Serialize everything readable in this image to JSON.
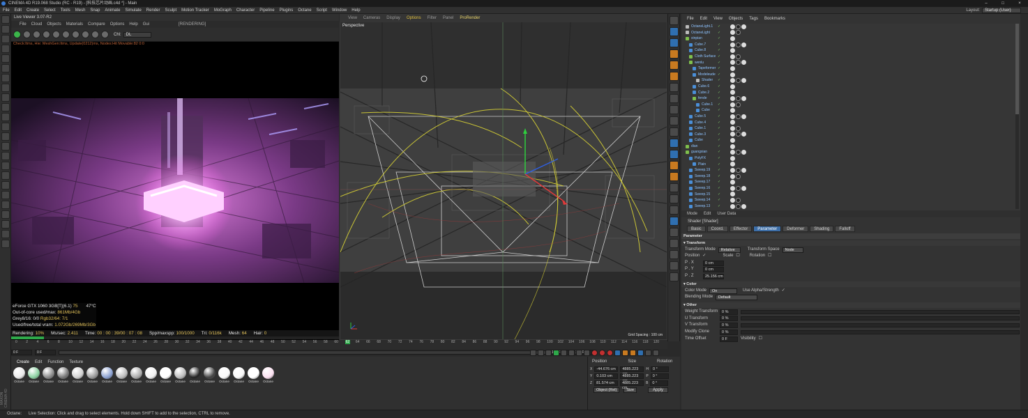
{
  "window": {
    "title": "CINEMA 4D R19.068 Studio (RC - R19) - [科技芯片动画.c4d *] - Main",
    "controls": [
      "–",
      "□",
      "×"
    ]
  },
  "menubar": [
    "File",
    "Edit",
    "Create",
    "Select",
    "Tools",
    "Mesh",
    "Snap",
    "Animate",
    "Simulate",
    "Render",
    "Sculpt",
    "Motion Tracker",
    "MoGraph",
    "Character",
    "Pipeline",
    "Plugins",
    "Octane",
    "Script",
    "Window",
    "Help"
  ],
  "layout": {
    "label": "Layout:",
    "value": "Startup (User)"
  },
  "liveviewer": {
    "title": "Live Viewer 3.07-R2",
    "menu": [
      "File",
      "Cloud",
      "Objects",
      "Materials",
      "Compare",
      "Options",
      "Help",
      "Gui"
    ],
    "status": "[RENDERING]",
    "channel_label": "Chl:",
    "channel_value": "DL",
    "checkline": "Check:Itms, Hie: MeshGen:Itms, Update(0212)ms, Nodes:Hit Movable:82 0:0",
    "stats": [
      {
        "label": "eForce GTX 1060 3GB[T](6.1)",
        "value": "75",
        "extra": "47°C"
      },
      {
        "label": "Out-of-core used/max:",
        "value": "861Mb/4Gb"
      },
      {
        "label": "Grey8/16: 0/0",
        "value": "Rgb32/64: 7/1"
      },
      {
        "label": "Used/free/total vram:",
        "value": "1.072Gb/269Mb/3Gb"
      }
    ],
    "bar": [
      {
        "label": "Rendering:",
        "value": "10%"
      },
      {
        "label": "Ms/sec:",
        "value": "2.411"
      },
      {
        "label": "Time:",
        "value": "00 : 00 : 39/00 : 07 : 08"
      },
      {
        "label": "Spp/maxspp:",
        "value": "100/1000"
      },
      {
        "label": "Tri:",
        "value": "0/116k"
      },
      {
        "label": "Mesh:",
        "value": "64"
      },
      {
        "label": "Hair:",
        "value": "0"
      }
    ],
    "progress": 0.1
  },
  "viewport": {
    "menu": [
      "View",
      "Cameras",
      "Display",
      "Options",
      "Filter",
      "Panel",
      "ProRender"
    ],
    "active_menu": "Options",
    "label": "Perspective",
    "grid": "Grid Spacing : 100 cm"
  },
  "objects": {
    "menu": [
      "File",
      "Edit",
      "View",
      "Objects",
      "Tags",
      "Bookmarks"
    ],
    "items": [
      {
        "name": "OctaneLight.1",
        "indent": 0,
        "icon": "w"
      },
      {
        "name": "OctaneLight",
        "indent": 0,
        "icon": "w"
      },
      {
        "name": "xinpian",
        "indent": 0,
        "icon": "g"
      },
      {
        "name": "Cube.7",
        "indent": 1,
        "icon": "b"
      },
      {
        "name": "Cube.8",
        "indent": 1,
        "icon": "b"
      },
      {
        "name": "Cloth Surface",
        "indent": 1,
        "icon": "g"
      },
      {
        "name": "wenlu",
        "indent": 1,
        "icon": "g"
      },
      {
        "name": "Tapeformer",
        "indent": 2,
        "icon": "b"
      },
      {
        "name": "Modeleude",
        "indent": 2,
        "icon": "b"
      },
      {
        "name": "Shader",
        "indent": 3,
        "icon": "w"
      },
      {
        "name": "Cube.6",
        "indent": 2,
        "icon": "b"
      },
      {
        "name": "Cube.2",
        "indent": 2,
        "icon": "b"
      },
      {
        "name": "fende",
        "indent": 2,
        "icon": "g"
      },
      {
        "name": "Cube.1",
        "indent": 3,
        "icon": "b"
      },
      {
        "name": "Cube",
        "indent": 3,
        "icon": "b"
      },
      {
        "name": "Cube.5",
        "indent": 1,
        "icon": "b"
      },
      {
        "name": "Cube.4",
        "indent": 1,
        "icon": "b"
      },
      {
        "name": "Cube.1",
        "indent": 1,
        "icon": "b"
      },
      {
        "name": "Cube.3",
        "indent": 1,
        "icon": "b"
      },
      {
        "name": "Cube",
        "indent": 1,
        "icon": "b"
      },
      {
        "name": "dian",
        "indent": 0,
        "icon": "g"
      },
      {
        "name": "guangxian",
        "indent": 0,
        "icon": "g"
      },
      {
        "name": "PolyFX",
        "indent": 1,
        "icon": "b"
      },
      {
        "name": "Plain",
        "indent": 2,
        "icon": "b"
      },
      {
        "name": "Sweep.19",
        "indent": 1,
        "icon": "b"
      },
      {
        "name": "Sweep.18",
        "indent": 1,
        "icon": "b"
      },
      {
        "name": "Sweep.17",
        "indent": 1,
        "icon": "b"
      },
      {
        "name": "Sweep.16",
        "indent": 1,
        "icon": "b"
      },
      {
        "name": "Sweep.15",
        "indent": 1,
        "icon": "b"
      },
      {
        "name": "Sweep.14",
        "indent": 1,
        "icon": "b"
      },
      {
        "name": "Sweep.13",
        "indent": 1,
        "icon": "b"
      }
    ]
  },
  "attributes": {
    "menu": [
      "Mode",
      "Edit",
      "User Data"
    ],
    "title": "Shader [Shader]",
    "tabs": [
      "Basic",
      "Coord.",
      "Effector",
      "Parameter",
      "Deformer",
      "Shading",
      "Falloff"
    ],
    "active_tab": "Parameter",
    "section_parameter": "Parameter",
    "section_transform": "Transform",
    "transform_mode_label": "Transform Mode",
    "transform_mode": "Relative",
    "transform_space_label": "Transform Space",
    "transform_space": "Node",
    "position_label": "Position",
    "scale_label": "Scale",
    "rotation_label": "Rotation",
    "px_label": "P . X",
    "px": "0 cm",
    "py_label": "P . Y",
    "py": "0 cm",
    "pz_label": "P . Z",
    "pz": "25.156 cm",
    "section_color": "Color",
    "color_mode_label": "Color Mode",
    "color_mode": "On",
    "use_alpha_label": "Use Alpha/Strength",
    "blending_mode_label": "Blending Mode",
    "blending_mode": "Default",
    "section_other": "Other",
    "others": [
      {
        "label": "Weight Transform",
        "value": "0 %"
      },
      {
        "label": "U Transform",
        "value": "0 %"
      },
      {
        "label": "V Transform",
        "value": "0 %"
      },
      {
        "label": "Modify Clone",
        "value": "0 %"
      }
    ],
    "time_offset_label": "Time Offset",
    "time_offset": "0 F",
    "visibility_label": "Visibility"
  },
  "timeline": {
    "ticks": [
      "0",
      "2",
      "4",
      "6",
      "8",
      "10",
      "12",
      "14",
      "16",
      "18",
      "20",
      "22",
      "24",
      "26",
      "28",
      "30",
      "32",
      "34",
      "36",
      "38",
      "40",
      "42",
      "44",
      "46",
      "48",
      "50",
      "52",
      "54",
      "56",
      "58",
      "60",
      "62",
      "64",
      "66",
      "68",
      "70",
      "72",
      "74",
      "76",
      "78",
      "80",
      "82",
      "84",
      "86",
      "88",
      "90",
      "92",
      "94",
      "96",
      "98",
      "100",
      "102",
      "104",
      "106",
      "108",
      "110",
      "112",
      "114",
      "116",
      "118",
      "120"
    ],
    "current": "62",
    "start": "0 F",
    "min": "0 F",
    "end": "110 F",
    "max": "110 F"
  },
  "materials": {
    "menu": [
      "Create",
      "Edit",
      "Function",
      "Texture"
    ],
    "items": [
      "Octane",
      "Octane",
      "Octane",
      "Octane",
      "Octane",
      "Octane",
      "Octane",
      "Octane",
      "Octane",
      "Octane",
      "Octane",
      "Octane",
      "Octane",
      "Octane",
      "Octane",
      "Octane",
      "Octane",
      "Octane"
    ]
  },
  "coords": {
    "headers": [
      "Position",
      "Size",
      "Rotation"
    ],
    "rows": [
      {
        "axis": "X",
        "pos": "-44.676 cm",
        "size": "4885.223 cm",
        "rl": "H",
        "rot": "0 °"
      },
      {
        "axis": "Y",
        "pos": "0.103 cm",
        "size": "4885.223 cm",
        "rl": "P",
        "rot": "0 °"
      },
      {
        "axis": "Z",
        "pos": "81.574 cm",
        "size": "4885.223 cm",
        "rl": "B",
        "rot": "0 °"
      }
    ],
    "mode": "Object (Rel)",
    "size_mode": "Size",
    "apply": "Apply"
  },
  "statusbar": {
    "left": "Octane:",
    "text": "Live Selection: Click and drag to select elements. Hold down SHIFT to add to the selection, CTRL to remove."
  },
  "maxon": "MAXON CINEMA 4D"
}
